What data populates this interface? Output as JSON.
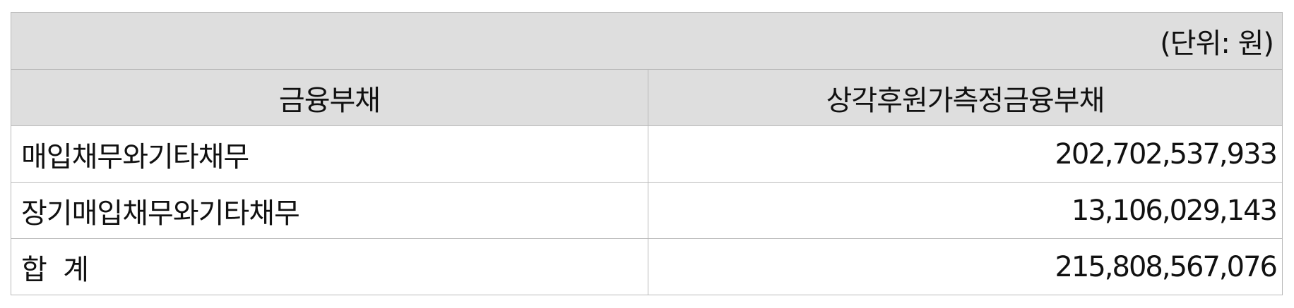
{
  "unit_note": "(단위: 원)",
  "columns": [
    "금융부채",
    "상각후원가측정금융부채"
  ],
  "rows": [
    {
      "label": "매입채무와기타채무",
      "value": "202,702,537,933"
    },
    {
      "label": "장기매입채무와기타채무",
      "value": "13,106,029,143"
    },
    {
      "label": "합  계",
      "value": "215,808,567,076"
    }
  ]
}
